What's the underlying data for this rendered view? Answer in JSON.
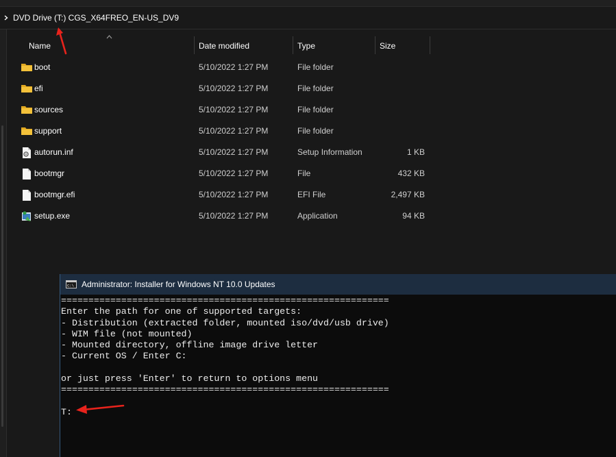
{
  "explorer": {
    "breadcrumb": "DVD Drive (T:) CGS_X64FREO_EN-US_DV9",
    "columns": {
      "name": "Name",
      "date": "Date modified",
      "type": "Type",
      "size": "Size"
    },
    "files": [
      {
        "name": "boot",
        "date": "5/10/2022 1:27 PM",
        "type": "File folder",
        "size": "",
        "icon": "folder-icon"
      },
      {
        "name": "efi",
        "date": "5/10/2022 1:27 PM",
        "type": "File folder",
        "size": "",
        "icon": "folder-icon"
      },
      {
        "name": "sources",
        "date": "5/10/2022 1:27 PM",
        "type": "File folder",
        "size": "",
        "icon": "folder-icon"
      },
      {
        "name": "support",
        "date": "5/10/2022 1:27 PM",
        "type": "File folder",
        "size": "",
        "icon": "folder-icon"
      },
      {
        "name": "autorun.inf",
        "date": "5/10/2022 1:27 PM",
        "type": "Setup Information",
        "size": "1 KB",
        "icon": "setup-info-file-icon"
      },
      {
        "name": "bootmgr",
        "date": "5/10/2022 1:27 PM",
        "type": "File",
        "size": "432 KB",
        "icon": "file-icon"
      },
      {
        "name": "bootmgr.efi",
        "date": "5/10/2022 1:27 PM",
        "type": "EFI File",
        "size": "2,497 KB",
        "icon": "file-icon"
      },
      {
        "name": "setup.exe",
        "date": "5/10/2022 1:27 PM",
        "type": "Application",
        "size": "94 KB",
        "icon": "setup-exe-icon"
      }
    ]
  },
  "console": {
    "title": "Administrator:  Installer for Windows NT 10.0 Updates",
    "lines": [
      "============================================================",
      "Enter the path for one of supported targets:",
      "- Distribution (extracted folder, mounted iso/dvd/usb drive)",
      "- WIM file (not mounted)",
      "- Mounted directory, offline image drive letter",
      "- Current OS / Enter C:",
      "",
      "or just press 'Enter' to return to options menu",
      "============================================================",
      "",
      "T:"
    ]
  },
  "colors": {
    "arrow": "#e8231c",
    "folder": "#f3c13a",
    "console_titlebar": "#1d2d40",
    "console_bg": "#0c0c0c"
  }
}
